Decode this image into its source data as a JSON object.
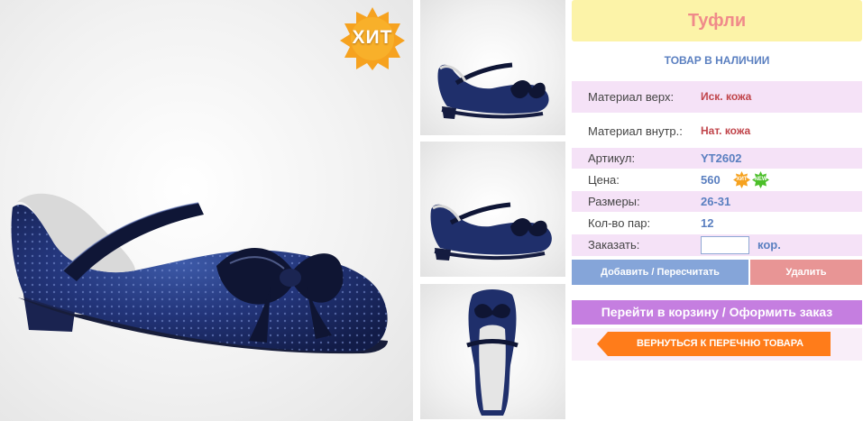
{
  "main_photo": {
    "alt": "shoe",
    "badge": "ХИТ"
  },
  "thumbnails": [
    {
      "view": "side"
    },
    {
      "view": "side"
    },
    {
      "view": "top"
    }
  ],
  "product": {
    "title": "Туфли",
    "stock_status": "ТОВАР В НАЛИЧИИ",
    "rows": {
      "material_top": {
        "label": "Материал верх:",
        "value": "Иск. кожа"
      },
      "material_inner": {
        "label": "Материал внутр.:",
        "value": "Нат. кожа"
      },
      "article": {
        "label": "Артикул:",
        "value": "YT2602"
      },
      "price": {
        "label": "Цена:",
        "value": "560",
        "badges": [
          "ХИТ",
          "NEW"
        ]
      },
      "sizes": {
        "label": "Размеры:",
        "value": "26-31"
      },
      "pairs": {
        "label": "Кол-во пар:",
        "value": "12"
      },
      "order": {
        "label": "Заказать:",
        "value": "",
        "unit": "кор."
      }
    }
  },
  "actions": {
    "add": "Добавить / Пересчитать",
    "delete": "Удалить",
    "cart": "Перейти в корзину / Оформить заказ",
    "back": "ВЕРНУТЬСЯ К ПЕРЕЧНЮ ТОВАРА"
  },
  "colors": {
    "title_bg": "#fcf3a8",
    "title_text": "#f08a8a",
    "row_pink": "#f5e2f7",
    "accent_blue": "#5a7fc0",
    "accent_red": "#c0444a",
    "btn_add": "#85a5d9",
    "btn_delete": "#e89595",
    "btn_cart": "#c57ee0",
    "btn_back": "#ff7c1a",
    "shoe": "#1f2f6b"
  }
}
